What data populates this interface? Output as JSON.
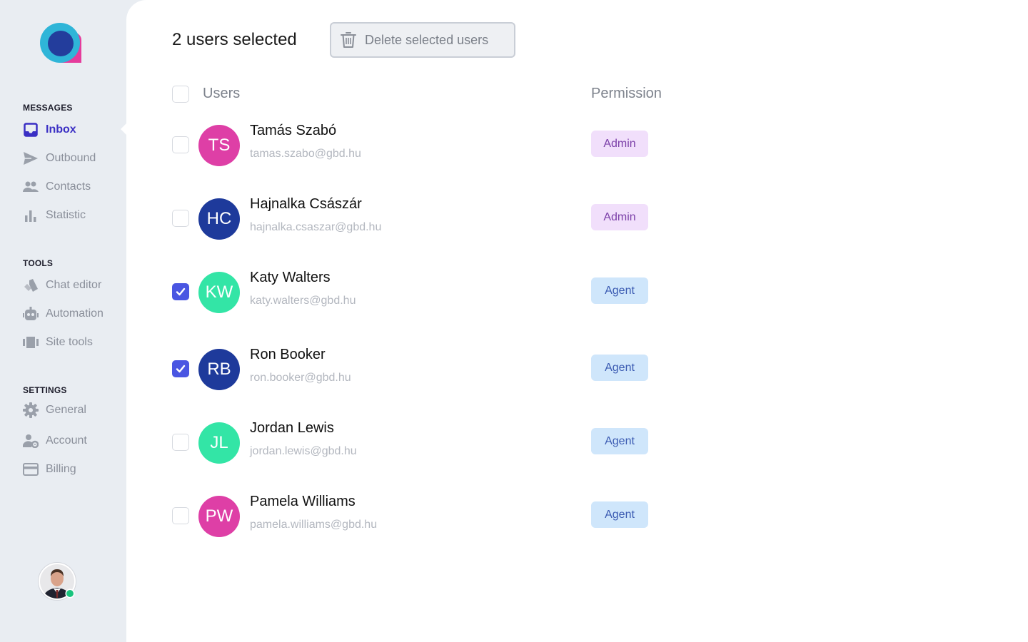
{
  "sidebar": {
    "sections": [
      {
        "title": "MESSAGES",
        "items": [
          {
            "label": "Inbox",
            "icon": "inbox-icon",
            "active": true
          },
          {
            "label": "Outbound",
            "icon": "send-icon"
          },
          {
            "label": "Contacts",
            "icon": "people-icon"
          },
          {
            "label": "Statistic",
            "icon": "bar-chart-icon"
          }
        ]
      },
      {
        "title": "TOOLS",
        "items": [
          {
            "label": "Chat editor",
            "icon": "pages-icon"
          },
          {
            "label": "Automation",
            "icon": "robot-icon"
          },
          {
            "label": "Site tools",
            "icon": "carousel-icon"
          }
        ]
      },
      {
        "title": "SETTINGS",
        "items": [
          {
            "label": "General",
            "icon": "gear-icon"
          },
          {
            "label": "Account",
            "icon": "user-settings-icon"
          },
          {
            "label": "Billing",
            "icon": "credit-card-icon"
          }
        ]
      }
    ],
    "profile": {
      "status": "online",
      "status_color": "#19c37d"
    }
  },
  "main": {
    "selected_count_text": "2 users selected",
    "delete_button_label": "Delete selected users",
    "columns": {
      "users": "Users",
      "permission": "Permission"
    },
    "users": [
      {
        "initials": "TS",
        "name": "Tamás Szabó",
        "email": "tamas.szabo@gbd.hu",
        "permission": "Admin",
        "checked": false,
        "avatar_color": "#de3fa6"
      },
      {
        "initials": "HC",
        "name": "Hajnalka Császár",
        "email": "hajnalka.csaszar@gbd.hu",
        "permission": "Admin",
        "checked": false,
        "avatar_color": "#1e3a9b"
      },
      {
        "initials": "KW",
        "name": "Katy Walters",
        "email": "katy.walters@gbd.hu",
        "permission": "Agent",
        "checked": true,
        "avatar_color": "#33e5a6"
      },
      {
        "initials": "RB",
        "name": "Ron Booker",
        "email": "ron.booker@gbd.hu",
        "permission": "Agent",
        "checked": true,
        "avatar_color": "#1e3a9b"
      },
      {
        "initials": "JL",
        "name": "Jordan Lewis",
        "email": "jordan.lewis@gbd.hu",
        "permission": "Agent",
        "checked": false,
        "avatar_color": "#33e5a6"
      },
      {
        "initials": "PW",
        "name": "Pamela Williams",
        "email": "pamela.williams@gbd.hu",
        "permission": "Agent",
        "checked": false,
        "avatar_color": "#de3fa6"
      }
    ]
  },
  "colors": {
    "accent": "#4a56e2",
    "active_nav": "#3a2fc4",
    "admin_badge_bg": "#f1dffb",
    "admin_badge_text": "#7b3fa8",
    "agent_badge_bg": "#cfe6fb",
    "agent_badge_text": "#3b5bb2"
  }
}
